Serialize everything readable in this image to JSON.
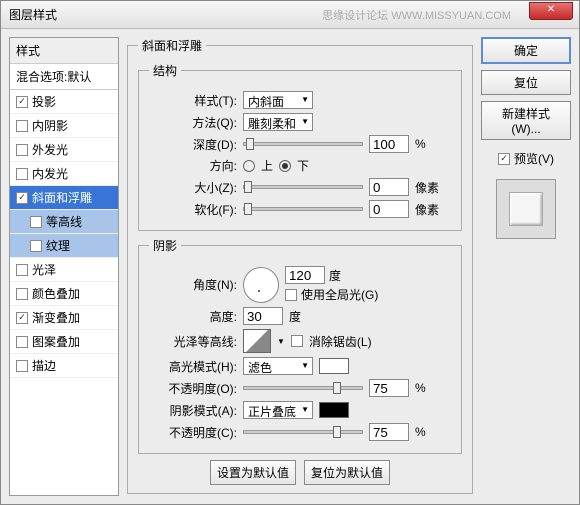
{
  "window": {
    "title": "图层样式",
    "watermark": "思缘设计论坛  WWW.MISSYUAN.COM"
  },
  "sidebar": {
    "header": "样式",
    "blend_default": "混合选项:默认",
    "items": [
      {
        "label": "投影",
        "checked": true
      },
      {
        "label": "内阴影",
        "checked": false
      },
      {
        "label": "外发光",
        "checked": false
      },
      {
        "label": "内发光",
        "checked": false
      },
      {
        "label": "斜面和浮雕",
        "checked": true,
        "selected": true
      },
      {
        "label": "等高线",
        "checked": false,
        "sub": true
      },
      {
        "label": "纹理",
        "checked": false,
        "sub": true
      },
      {
        "label": "光泽",
        "checked": false
      },
      {
        "label": "颜色叠加",
        "checked": false
      },
      {
        "label": "渐变叠加",
        "checked": true
      },
      {
        "label": "图案叠加",
        "checked": false
      },
      {
        "label": "描边",
        "checked": false
      }
    ]
  },
  "main": {
    "section_title": "斜面和浮雕",
    "structure": {
      "legend": "结构",
      "style_label": "样式(T):",
      "style_value": "内斜面",
      "method_label": "方法(Q):",
      "method_value": "雕刻柔和",
      "depth_label": "深度(D):",
      "depth_value": "100",
      "depth_unit": "%",
      "direction_label": "方向:",
      "up": "上",
      "down": "下",
      "size_label": "大小(Z):",
      "size_value": "0",
      "size_unit": "像素",
      "soften_label": "软化(F):",
      "soften_value": "0",
      "soften_unit": "像素"
    },
    "shading": {
      "legend": "阴影",
      "angle_label": "角度(N):",
      "angle_value": "120",
      "angle_unit": "度",
      "global_light": "使用全局光(G)",
      "altitude_label": "高度:",
      "altitude_value": "30",
      "altitude_unit": "度",
      "gloss_label": "光泽等高线:",
      "antialias": "消除锯齿(L)",
      "highlight_mode_label": "高光模式(H):",
      "highlight_mode_value": "滤色",
      "highlight_opacity_label": "不透明度(O):",
      "highlight_opacity_value": "75",
      "opacity_unit": "%",
      "shadow_mode_label": "阴影模式(A):",
      "shadow_mode_value": "正片叠底",
      "shadow_opacity_label": "不透明度(C):",
      "shadow_opacity_value": "75"
    },
    "buttons": {
      "set_default": "设置为默认值",
      "reset_default": "复位为默认值"
    }
  },
  "side": {
    "ok": "确定",
    "cancel": "复位",
    "new_style": "新建样式(W)...",
    "preview": "预览(V)"
  }
}
